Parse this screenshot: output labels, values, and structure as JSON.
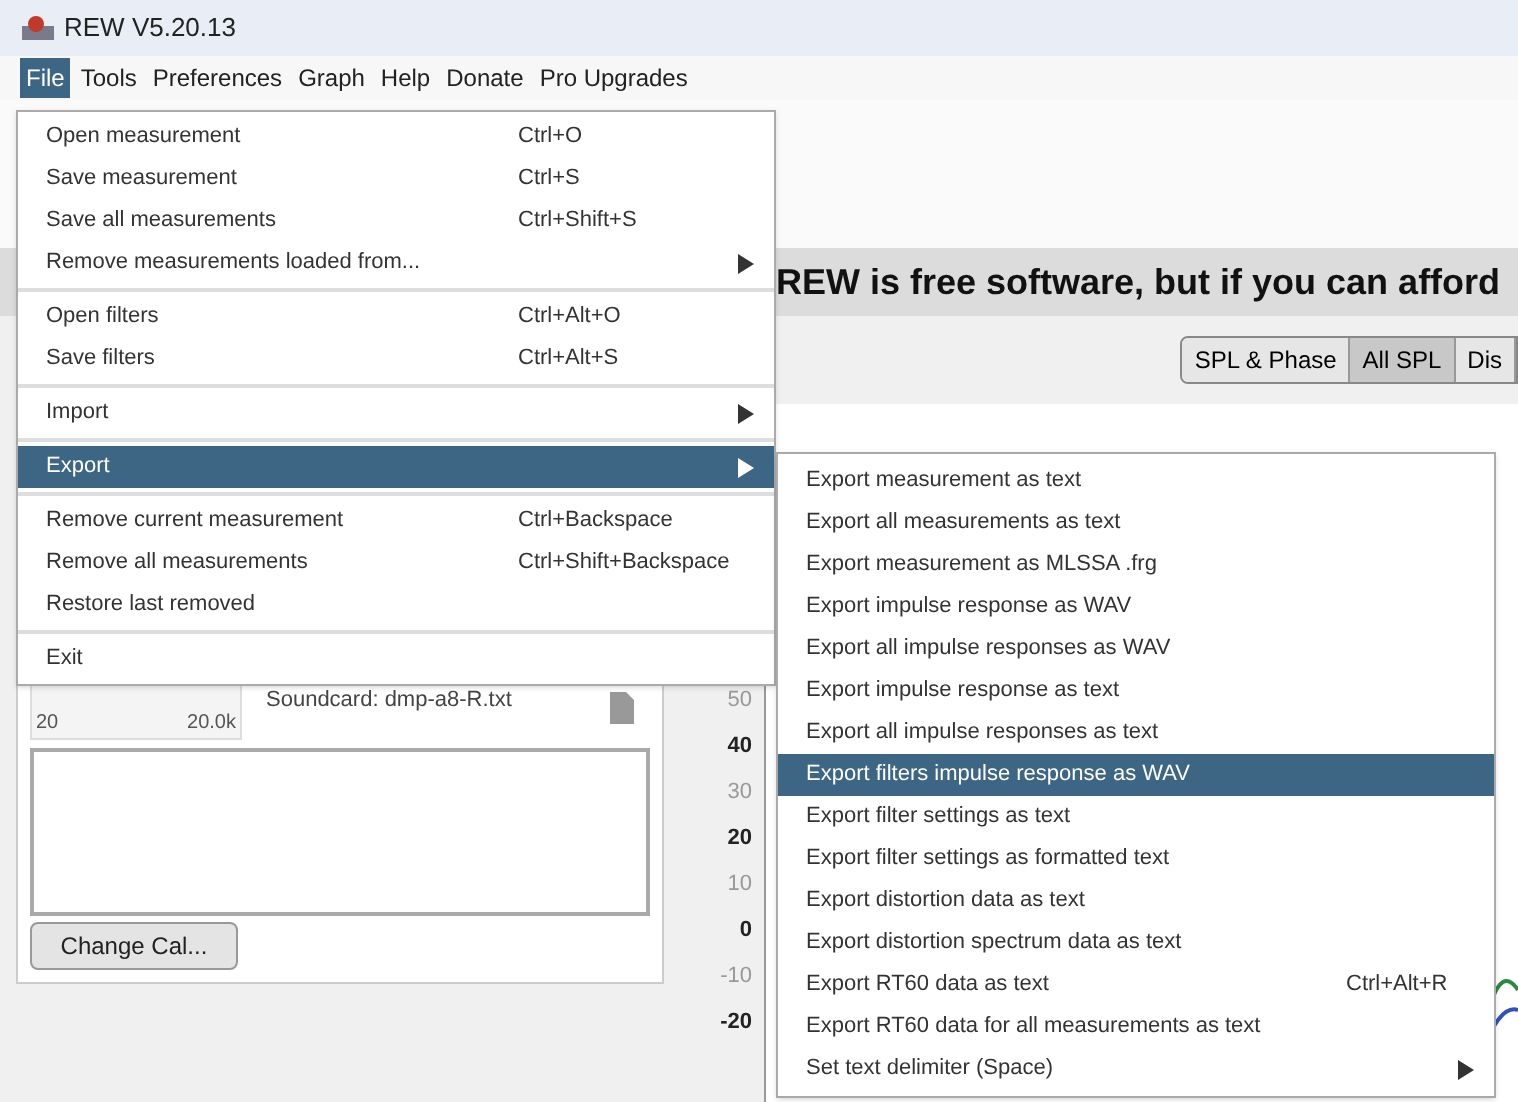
{
  "window": {
    "title": "REW V5.20.13"
  },
  "menubar": [
    {
      "label": "File",
      "selected": true
    },
    {
      "label": "Tools",
      "selected": false
    },
    {
      "label": "Preferences",
      "selected": false
    },
    {
      "label": "Graph",
      "selected": false
    },
    {
      "label": "Help",
      "selected": false
    },
    {
      "label": "Donate",
      "selected": false
    },
    {
      "label": "Pro Upgrades",
      "selected": false
    }
  ],
  "banner": "REW is free software, but if you can afford",
  "graph_tabs": [
    {
      "label": "SPL & Phase",
      "selected": false
    },
    {
      "label": "All SPL",
      "selected": true
    },
    {
      "label": "Dis",
      "selected": false
    }
  ],
  "file_menu": [
    [
      {
        "label": "Open measurement",
        "shortcut": "Ctrl+O",
        "submenu": false,
        "selected": false
      },
      {
        "label": "Save measurement",
        "shortcut": "Ctrl+S",
        "submenu": false,
        "selected": false
      },
      {
        "label": "Save all measurements",
        "shortcut": "Ctrl+Shift+S",
        "submenu": false,
        "selected": false
      },
      {
        "label": "Remove measurements loaded from...",
        "submenu": true,
        "selected": false
      }
    ],
    [
      {
        "label": "Open filters",
        "shortcut": "Ctrl+Alt+O",
        "submenu": false,
        "selected": false
      },
      {
        "label": "Save filters",
        "shortcut": "Ctrl+Alt+S",
        "submenu": false,
        "selected": false
      }
    ],
    [
      {
        "label": "Import",
        "submenu": true,
        "selected": false
      }
    ],
    [
      {
        "label": "Export",
        "submenu": true,
        "selected": true
      }
    ],
    [
      {
        "label": "Remove current measurement",
        "shortcut": "Ctrl+Backspace",
        "submenu": false,
        "selected": false
      },
      {
        "label": "Remove all measurements",
        "shortcut": "Ctrl+Shift+Backspace",
        "submenu": false,
        "selected": false
      },
      {
        "label": "Restore last removed",
        "submenu": false,
        "selected": false
      }
    ],
    [
      {
        "label": "Exit",
        "submenu": false,
        "selected": false
      }
    ]
  ],
  "export_menu": [
    {
      "label": "Export measurement as text",
      "submenu": false,
      "selected": false
    },
    {
      "label": "Export all measurements as text",
      "submenu": false,
      "selected": false
    },
    {
      "label": "Export measurement as MLSSA .frg",
      "submenu": false,
      "selected": false
    },
    {
      "label": "Export impulse response as WAV",
      "submenu": false,
      "selected": false
    },
    {
      "label": "Export all impulse responses as WAV",
      "submenu": false,
      "selected": false
    },
    {
      "label": "Export impulse response as text",
      "submenu": false,
      "selected": false
    },
    {
      "label": "Export all impulse responses as text",
      "submenu": false,
      "selected": false
    },
    {
      "label": "Export filters impulse response as WAV",
      "submenu": false,
      "selected": true
    },
    {
      "label": "Export filter settings as text",
      "submenu": false,
      "selected": false
    },
    {
      "label": "Export filter settings as formatted text",
      "submenu": false,
      "selected": false
    },
    {
      "label": "Export distortion data as text",
      "submenu": false,
      "selected": false
    },
    {
      "label": "Export distortion spectrum data as text",
      "submenu": false,
      "selected": false
    },
    {
      "label": "Export RT60 data as text",
      "shortcut": "Ctrl+Alt+R",
      "submenu": false,
      "selected": false
    },
    {
      "label": "Export RT60 data for all measurements as text",
      "submenu": false,
      "selected": false
    },
    {
      "label": "Set text delimiter (Space)",
      "submenu": true,
      "selected": false
    }
  ],
  "cal_panel": {
    "thumb_min": "20",
    "thumb_max": "20.0k",
    "file": "Soundcard: dmp-a8-R.txt",
    "button": "Change Cal..."
  },
  "y_axis": [
    "50",
    "40",
    "30",
    "20",
    "10",
    "0",
    "-10",
    "-20"
  ]
}
